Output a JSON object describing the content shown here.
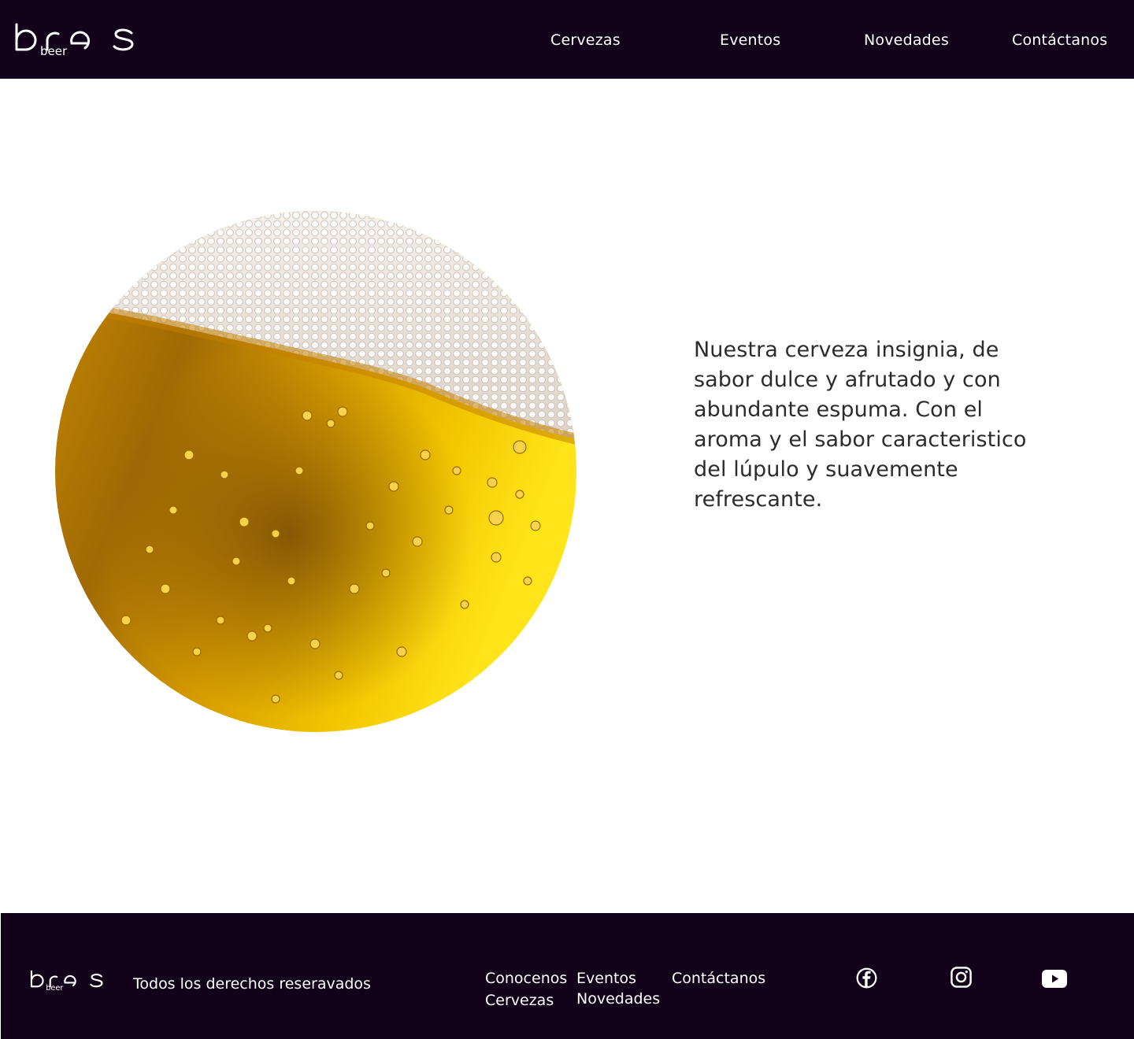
{
  "brand": {
    "logo_text": "bres",
    "logo_subtext": "beer"
  },
  "nav": {
    "items": [
      {
        "label": "Cervezas"
      },
      {
        "label": "Eventos"
      },
      {
        "label": "Novedades"
      },
      {
        "label": "Contáctanos"
      }
    ]
  },
  "hero": {
    "image_icon": "beer-photo",
    "description": "Nuestra cerveza insignia, de sabor dulce y afrutado y con abundante espuma. Con el aroma y el sabor caracteristico del lúpulo y suavemente refrescante."
  },
  "footer": {
    "rights": "Todos los derechos reseravados",
    "links": {
      "conocenos": "Conocenos",
      "cervezas": "Cervezas",
      "eventos": "Eventos",
      "novedades": "Novedades",
      "contactanos": "Contáctanos"
    },
    "social": [
      "facebook-icon",
      "instagram-icon",
      "youtube-icon"
    ]
  },
  "colors": {
    "dark": "#12021a",
    "beer": "#e6b000",
    "foam": "#f1ebe6",
    "text": "#2c2c2c"
  }
}
